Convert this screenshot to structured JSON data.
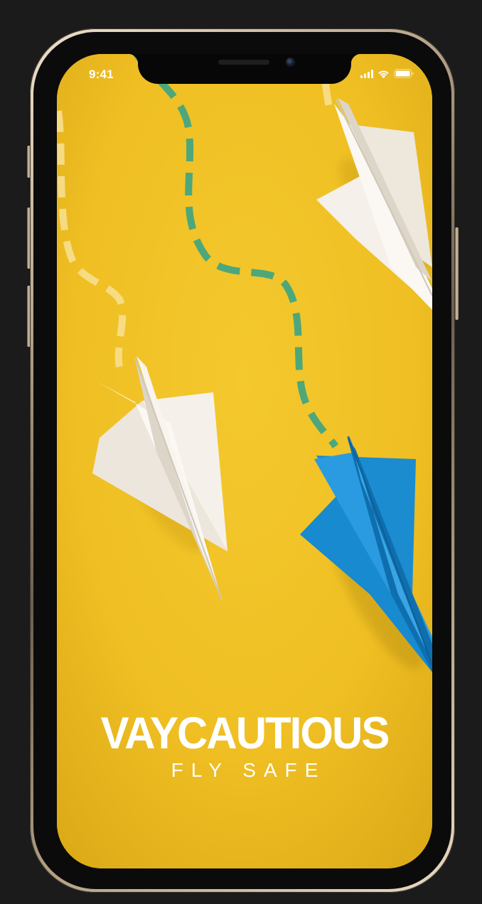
{
  "status_bar": {
    "time": "9:41",
    "icons": [
      "signal-icon",
      "wifi-icon",
      "battery-icon"
    ]
  },
  "brand": {
    "title": "VAYCAUTIOUS",
    "tagline": "FLY SAFE"
  },
  "colors": {
    "background_yellow": "#f0c125",
    "path_green": "#4fa77a",
    "path_light": "#f6dc8a",
    "plane_white": "#f4efe8",
    "plane_blue": "#1f8fd1",
    "frame_gold": "#d8c6a6"
  }
}
